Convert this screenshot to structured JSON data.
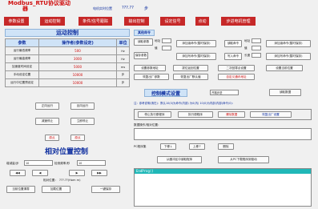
{
  "header": {
    "title_line1": "Modbus_RTU协议驱动",
    "title_line2": "器",
    "pos_label": "电机实时位置",
    "pos_value": "???.??",
    "pos_unit": "步"
  },
  "nav": [
    "参数设置",
    "运动控制",
    "条件/信号跟踪",
    "输出控制",
    "设定信号",
    "点动",
    "步进电机管理"
  ],
  "motion": {
    "section_title": "运动控制",
    "table_headers": [
      "参数",
      "操作者(参数设定)",
      "单位"
    ],
    "rows": [
      {
        "name": "运行最低频率",
        "value": "500",
        "unit": "Hz"
      },
      {
        "name": "运行最高频率",
        "value": "3000",
        "unit": "Hz"
      },
      {
        "name": "加速度时间设定",
        "value": "5000",
        "unit": "ms"
      },
      {
        "name": "手动设定位置",
        "value": "10000",
        "unit": "步"
      },
      {
        "name": "运行中位置预设定",
        "value": "10000",
        "unit": "步"
      }
    ],
    "buttons": [
      "正向运行",
      "反向运行",
      "减速停止",
      "立即停止"
    ],
    "red_labels": [
      "原点",
      "原点"
    ]
  },
  "relative": {
    "section_title": "相对位置控制",
    "mode_label": "增减量/步",
    "mode_value": "10",
    "speed_label": "检测频率/秒",
    "speed_value": "10",
    "target_label": "相对位置：",
    "target_value": "???.??(Hom m)",
    "buttons": [
      "当前位置清零",
      "加载位置",
      "一键保存"
    ]
  },
  "other": {
    "section_title": "其他命令",
    "left_buttons": [
      "读取参数",
      "保存参数"
    ],
    "left_inputs": [
      "地址",
      "值"
    ],
    "write_buttons": [
      "添加读命令(暂时保存)",
      "添加写命令(暂时保存)"
    ],
    "mid_buttons": [
      "读取命令",
      "写入命令"
    ],
    "right_inputs": [
      "地址",
      "值",
      "长度"
    ],
    "right_buttons": [
      "添加读命令(暂时保存)",
      "添加写命令(暂时保存)"
    ],
    "row3": [
      "设置参数地址",
      "拔位返回位置",
      "二次回零点设置",
      "设置当前位置"
    ],
    "row4": [
      "恢复出厂参数",
      "恢复出厂默认值",
      "自定义通讯地址"
    ],
    "control_label": "控制模式设置",
    "control_value": "开路步进",
    "read_button": "读取数据",
    "note": "注：参考说明(请在)：默认10(0)为命令(内部) 为0(內) 10(0)为内部(内部)命令(0)：",
    "status_buttons": [
      "停止执行原程序",
      "执行原程序",
      "清除数据",
      "恢复出厂设置"
    ],
    "input_label": "数据操作/相对位置：",
    "pc_label": "PC程序集",
    "pc_buttons": [
      "下移↓",
      "上移↑",
      "删除"
    ],
    "bottom_buttons": [
      "从缓冲区中读取程序",
      "从PC下载程序到驱动"
    ],
    "console_text": "EndProg()"
  }
}
